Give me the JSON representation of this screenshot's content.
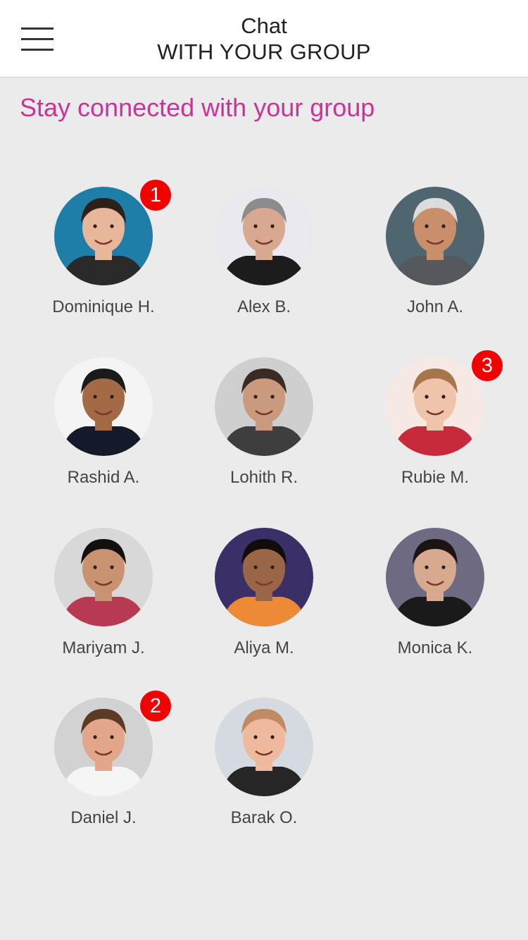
{
  "header": {
    "title": "Chat",
    "subtitle": "WITH YOUR GROUP",
    "menu_icon": "hamburger-menu-icon"
  },
  "tagline": "Stay connected with your group",
  "colors": {
    "accent": "#cc3399",
    "badge": "#f30000",
    "background": "#ebebeb"
  },
  "contacts": [
    {
      "name": "Dominique H.",
      "badge": "1",
      "bg": "#1e7ea8",
      "skin": "#e8b79a",
      "hair": "#2d1f1a",
      "shirt": "#2a2a2a"
    },
    {
      "name": "Alex B.",
      "badge": "",
      "bg": "#e9e9ef",
      "skin": "#d9a890",
      "hair": "#8c8c8c",
      "shirt": "#1c1c1c"
    },
    {
      "name": "John A.",
      "badge": "",
      "bg": "#4f6670",
      "skin": "#c98e6c",
      "hair": "#dcdcdc",
      "shirt": "#55585c"
    },
    {
      "name": "Rashid A.",
      "badge": "",
      "bg": "#f4f4f4",
      "skin": "#a36a45",
      "hair": "#1a1a1a",
      "shirt": "#141a2a"
    },
    {
      "name": "Lohith R.",
      "badge": "",
      "bg": "#cfcfcf",
      "skin": "#c99a7d",
      "hair": "#3a2c24",
      "shirt": "#3e3e3e"
    },
    {
      "name": "Rubie M.",
      "badge": "3",
      "bg": "#f6e9e3",
      "skin": "#f0c3ab",
      "hair": "#a8754a",
      "shirt": "#c62a3b"
    },
    {
      "name": "Mariyam J.",
      "badge": "",
      "bg": "#d8d8d8",
      "skin": "#c99270",
      "hair": "#140f0f",
      "shirt": "#b73a52"
    },
    {
      "name": "Aliya M.",
      "badge": "",
      "bg": "#3a2f66",
      "skin": "#9b6647",
      "hair": "#120d0d",
      "shirt": "#ee8a36"
    },
    {
      "name": "Monica K.",
      "badge": "",
      "bg": "#6e6a82",
      "skin": "#d7a98e",
      "hair": "#1b1412",
      "shirt": "#1a1a1a"
    },
    {
      "name": "Daniel J.",
      "badge": "2",
      "bg": "#d2d2d2",
      "skin": "#e2a68a",
      "hair": "#5b3b24",
      "shirt": "#f5f5f5"
    },
    {
      "name": "Barak O.",
      "badge": "",
      "bg": "#d4dadf",
      "skin": "#efb99d",
      "hair": "#c08a64",
      "shirt": "#262626"
    }
  ]
}
